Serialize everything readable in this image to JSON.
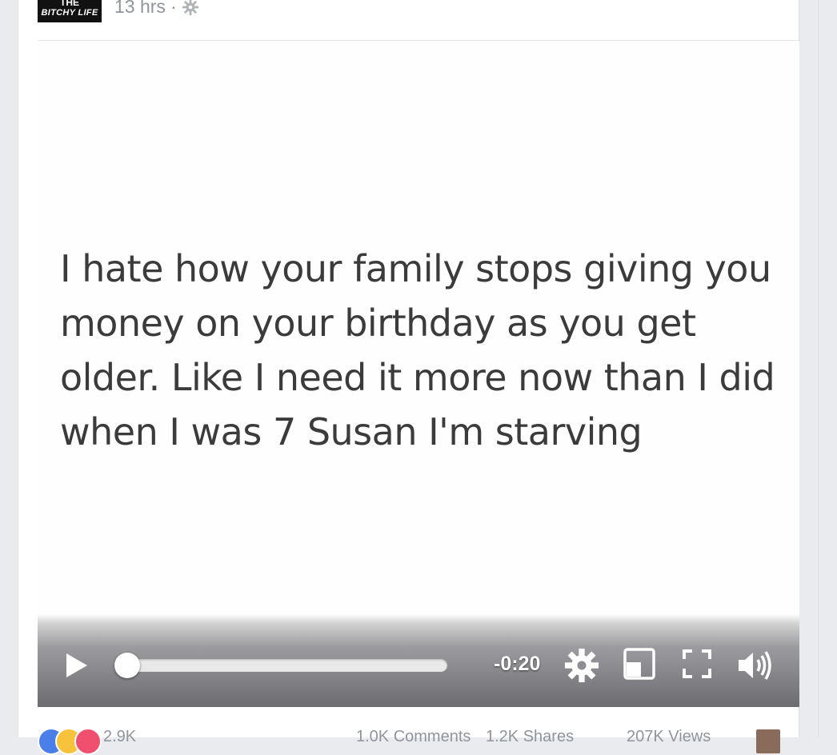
{
  "post": {
    "page_logo": {
      "line1": "THE",
      "line2": "BITCHY LIFE"
    },
    "time_ago": "13 hrs",
    "separator": "·",
    "privacy_icon": "gear-icon"
  },
  "video": {
    "caption_text": "I hate how your family stops giving you money on your birthday as you get older. Like I need it more now than I did when I was 7 Susan I'm starving",
    "controls": {
      "play_icon": "play-icon",
      "progress": 0,
      "time_remaining": "-0:20",
      "settings_icon": "gear-icon",
      "miniplayer_icon": "miniplayer-icon",
      "fullscreen_icon": "fullscreen-icon",
      "volume_icon": "volume-icon"
    }
  },
  "footer": {
    "reactions": [
      "like",
      "haha",
      "love"
    ],
    "reactions_count": "2.9K",
    "comments": "1.0K Comments",
    "shares": "1.2K Shares",
    "views": "207K Views"
  },
  "colors": {
    "page_background": "#e9ebee",
    "meta_text": "#90949c",
    "caption_text": "#3b3b3b",
    "like_blue": "#4a7ee8",
    "haha_yellow": "#f7c23c",
    "love_red": "#f0506e"
  }
}
